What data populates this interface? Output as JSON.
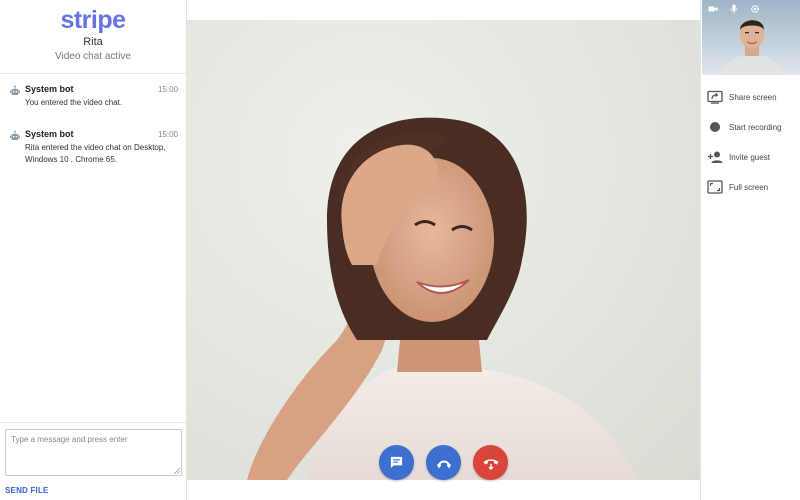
{
  "brand": {
    "logo": "stripe"
  },
  "contact": {
    "name": "Rita",
    "status": "Video chat active"
  },
  "messages": [
    {
      "sender": "System bot",
      "time": "15:00",
      "text": "You entered the video chat."
    },
    {
      "sender": "System bot",
      "time": "15:00",
      "text": "Rita entered the video chat on Desktop, Windows 10 , Chrome 65."
    }
  ],
  "composer": {
    "placeholder": "Type a message and press enter",
    "send_file_label": "SEND FILE"
  },
  "self_view_toolbar": {
    "icons": [
      "camera-icon",
      "microphone-icon",
      "settings-icon"
    ]
  },
  "actions": [
    {
      "label": "Share screen",
      "icon": "share-screen-icon"
    },
    {
      "label": "Start recording",
      "icon": "record-icon"
    },
    {
      "label": "Invite guest",
      "icon": "add-person-icon"
    },
    {
      "label": "Full screen",
      "icon": "fullscreen-icon"
    }
  ],
  "call_controls": [
    {
      "icon": "chat-icon"
    },
    {
      "icon": "switch-camera-icon"
    },
    {
      "icon": "hangup-icon"
    }
  ],
  "colors": {
    "brand": "#6772e5",
    "primary_button": "#3d6fd1",
    "hangup": "#d9453b",
    "send_file": "#3f5bd8"
  }
}
